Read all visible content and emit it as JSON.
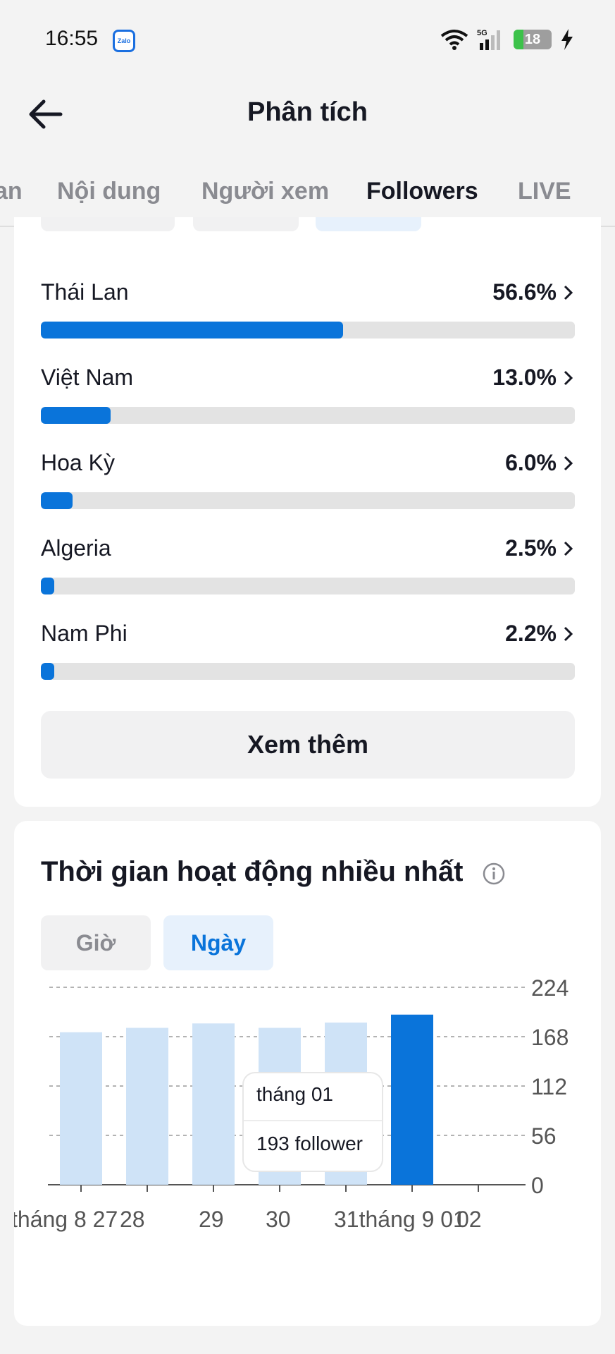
{
  "status_bar": {
    "time": "16:55",
    "app_badge": "Zalo",
    "network": "5G",
    "battery": "18"
  },
  "header": {
    "title": "Phân tích",
    "back_icon": "arrow-left-icon"
  },
  "tabs": [
    {
      "label": "an",
      "active": false
    },
    {
      "label": "Nội dung",
      "active": false
    },
    {
      "label": "Người xem",
      "active": false
    },
    {
      "label": "Followers",
      "active": true
    },
    {
      "label": "LIVE",
      "active": false
    }
  ],
  "countries": [
    {
      "name": "Thái Lan",
      "percent_label": "56.6%",
      "percent": 56.6
    },
    {
      "name": "Việt Nam",
      "percent_label": "13.0%",
      "percent": 13.0
    },
    {
      "name": "Hoa Kỳ",
      "percent_label": "6.0%",
      "percent": 6.0
    },
    {
      "name": "Algeria",
      "percent_label": "2.5%",
      "percent": 2.5
    },
    {
      "name": "Nam Phi",
      "percent_label": "2.2%",
      "percent": 2.2
    }
  ],
  "see_more_label": "Xem thêm",
  "activity": {
    "title": "Thời gian hoạt động nhiều nhất",
    "segments": {
      "hour": "Giờ",
      "day": "Ngày"
    },
    "selected_segment": "day",
    "tooltip": {
      "date": "tháng 01",
      "value": "193 follower"
    }
  },
  "colors": {
    "accent": "#0a74da",
    "bar_light": "#cfe3f7",
    "track": "#e3e3e3"
  },
  "chart_data": {
    "type": "bar",
    "categories": [
      "tháng 8 27",
      "28",
      "29",
      "30",
      "31",
      "tháng 9 01",
      "02"
    ],
    "x_tick_labels": [
      "tháng 8 27",
      "28",
      "29",
      "30",
      "31tháng 9 01",
      "02"
    ],
    "values": [
      173,
      178,
      183,
      178,
      184,
      193,
      null
    ],
    "highlight_index": 5,
    "y_ticks": [
      0,
      56,
      112,
      168,
      224
    ],
    "ylim": [
      0,
      224
    ],
    "grid": true,
    "y_axis_side": "right"
  }
}
